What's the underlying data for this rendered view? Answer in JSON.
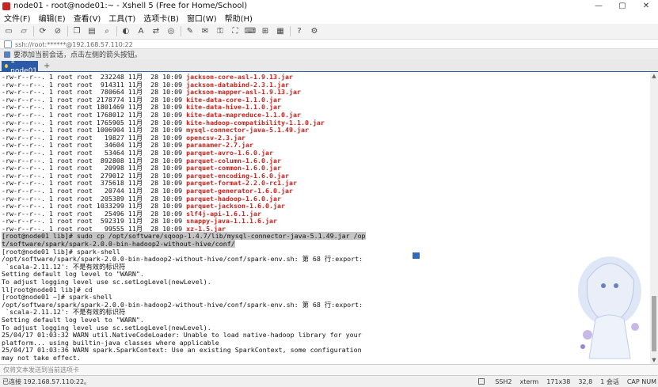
{
  "window": {
    "title": "node01 - root@node01:~ - Xshell 5 (Free for Home/School)",
    "controls": [
      "—",
      "▢",
      "✕"
    ]
  },
  "menu": [
    "文件(F)",
    "编辑(E)",
    "查看(V)",
    "工具(T)",
    "选项卡(B)",
    "窗口(W)",
    "帮助(H)"
  ],
  "address": "ssh://root:******@192.168.57.110:22",
  "hint": "要添加当前会话，点击左侧的箭头按钮。",
  "tabs": [
    {
      "label": "1 node01"
    }
  ],
  "tab_add": "+",
  "terminal": {
    "listing": [
      {
        "prefix": "-rw-r--r--. 1 root root  232248 11月  28 10:09 ",
        "file": "jackson-core-asl-1.9.13.jar"
      },
      {
        "prefix": "-rw-r--r--. 1 root root  914311 11月  28 10:09 ",
        "file": "jackson-databind-2.3.1.jar"
      },
      {
        "prefix": "-rw-r--r--. 1 root root  780664 11月  28 10:09 ",
        "file": "jackson-mapper-asl-1.9.13.jar"
      },
      {
        "prefix": "-rw-r--r--. 1 root root 2178774 11月  28 10:09 ",
        "file": "kite-data-core-1.1.0.jar"
      },
      {
        "prefix": "-rw-r--r--. 1 root root 1801469 11月  28 10:09 ",
        "file": "kite-data-hive-1.1.0.jar"
      },
      {
        "prefix": "-rw-r--r--. 1 root root 1768012 11月  28 10:09 ",
        "file": "kite-data-mapreduce-1.1.0.jar"
      },
      {
        "prefix": "-rw-r--r--. 1 root root 1765905 11月  28 10:09 ",
        "file": "kite-hadoop-compatibility-1.1.0.jar"
      },
      {
        "prefix": "-rw-r--r--. 1 root root 1006904 11月  28 10:09 ",
        "file": "mysql-connector-java-5.1.49.jar"
      },
      {
        "prefix": "-rw-r--r--. 1 root root   19827 11月  28 10:09 ",
        "file": "opencsv-2.3.jar"
      },
      {
        "prefix": "-rw-r--r--. 1 root root   34604 11月  28 10:09 ",
        "file": "paranamer-2.7.jar"
      },
      {
        "prefix": "-rw-r--r--. 1 root root   53464 11月  28 10:09 ",
        "file": "parquet-avro-1.6.0.jar"
      },
      {
        "prefix": "-rw-r--r--. 1 root root  892808 11月  28 10:09 ",
        "file": "parquet-column-1.6.0.jar"
      },
      {
        "prefix": "-rw-r--r--. 1 root root   20998 11月  28 10:09 ",
        "file": "parquet-common-1.6.0.jar"
      },
      {
        "prefix": "-rw-r--r--. 1 root root  279012 11月  28 10:09 ",
        "file": "parquet-encoding-1.6.0.jar"
      },
      {
        "prefix": "-rw-r--r--. 1 root root  375618 11月  28 10:09 ",
        "file": "parquet-format-2.2.0-rc1.jar"
      },
      {
        "prefix": "-rw-r--r--. 1 root root   20744 11月  28 10:09 ",
        "file": "parquet-generator-1.6.0.jar"
      },
      {
        "prefix": "-rw-r--r--. 1 root root  205389 11月  28 10:09 ",
        "file": "parquet-hadoop-1.6.0.jar"
      },
      {
        "prefix": "-rw-r--r--. 1 root root 1033299 11月  28 10:09 ",
        "file": "parquet-jackson-1.6.0.jar"
      },
      {
        "prefix": "-rw-r--r--. 1 root root   25496 11月  28 10:09 ",
        "file": "slf4j-api-1.6.1.jar"
      },
      {
        "prefix": "-rw-r--r--. 1 root root  592319 11月  28 10:09 ",
        "file": "snappy-java-1.1.1.6.jar"
      },
      {
        "prefix": "-rw-r--r--. 1 root root   99555 11月  28 10:09 ",
        "file": "xz-1.5.jar"
      }
    ],
    "selected": [
      "[root@node01 lib]# sudo cp /opt/software/sqoop-1.4.7/lib/mysql-connector-java-5.1.49.jar /op",
      "t/software/spark/spark-2.0.0-bin-hadoop2-without-hive/conf/"
    ],
    "output": [
      "[root@node01 lib]# spark-shell",
      "/opt/software/spark/spark-2.0.0-bin-hadoop2-without-hive/conf/spark-env.sh: 第 68 行:export:",
      " `scala-2.11.12': 不是有效的标识符",
      "Setting default log level to \"WARN\".",
      "To adjust logging level use sc.setLogLevel(newLevel).",
      "ll[root@node01 lib]# cd",
      "[root@node01 ~]# spark-shell",
      "/opt/software/spark/spark-2.0.0-bin-hadoop2-without-hive/conf/spark-env.sh: 第 68 行:export:",
      " `scala-2.11.12': 不是有效的标识符",
      "Setting default log level to \"WARN\".",
      "To adjust logging level use sc.setLogLevel(newLevel).",
      "25/04/17 01:03:32 WARN util.NativeCodeLoader: Unable to load native-hadoop library for your",
      "platform... using builtin-java classes where applicable",
      "25/04/17 01:03:36 WARN spark.SparkContext: Use an existing SparkContext, some configuration",
      "may not take effect."
    ]
  },
  "input_placeholder": "仅将文本发送到当前选项卡",
  "status": {
    "connection": "已连接 192.168.57.110:22。",
    "protocol": "SSH2",
    "term": "xterm",
    "size": "171x38",
    "cursor": "32,8",
    "sessions": "1 会话",
    "caps": "CAP NUM"
  },
  "colors": {
    "file_red": "#c8211b",
    "tab_blue": "#2a5ba8",
    "selection": "#c4c4c4"
  }
}
